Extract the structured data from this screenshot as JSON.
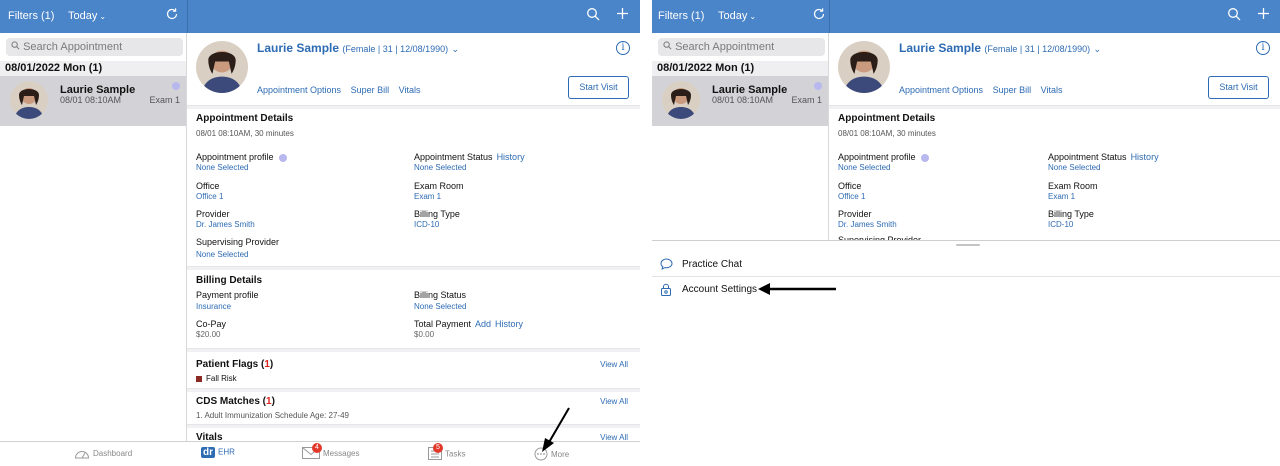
{
  "topbar": {
    "filters_label": "Filters (1)",
    "today_label": "Today",
    "chevron": "⌄",
    "refresh_icon": "refresh-icon",
    "search_icon": "search-icon",
    "add_icon": "plus-icon"
  },
  "list": {
    "search_placeholder": "Search Appointment",
    "date_header": "08/01/2022 Mon (1)",
    "appointment": {
      "name": "Laurie Sample",
      "time": "08/01 08:10AM",
      "room": "Exam 1"
    }
  },
  "patient": {
    "name": "Laurie Sample",
    "meta": "(Female | 31 | 12/08/1990)",
    "links": [
      "Appointment Options",
      "Super Bill",
      "Vitals"
    ],
    "start_visit": "Start Visit"
  },
  "appointment_details": {
    "title": "Appointment Details",
    "subtitle": "08/01 08:10AM, 30 minutes",
    "profile_label": "Appointment profile",
    "profile_value": "None Selected",
    "status_label": "Appointment Status",
    "status_history": "History",
    "status_value": "None Selected",
    "office_label": "Office",
    "office_value": "Office 1",
    "exam_room_label": "Exam Room",
    "exam_room_value": "Exam 1",
    "provider_label": "Provider",
    "provider_value": "Dr. James Smith",
    "billing_type_label": "Billing Type",
    "billing_type_value": "ICD-10",
    "supervising_label": "Supervising Provider",
    "supervising_value": "None Selected"
  },
  "billing_details": {
    "title": "Billing Details",
    "payment_profile_label": "Payment profile",
    "payment_profile_value": "Insurance",
    "billing_status_label": "Billing Status",
    "billing_status_value": "None Selected",
    "copay_label": "Co-Pay",
    "copay_value": "$20.00",
    "total_payment_label": "Total Payment",
    "total_add": "Add",
    "total_history": "History",
    "total_payment_value": "$0.00"
  },
  "patient_flags": {
    "title": "Patient Flags",
    "count": "1",
    "view_all": "View All",
    "flag": "Fall Risk"
  },
  "cds": {
    "title": "CDS Matches",
    "count": "1",
    "view_all": "View All",
    "item": "1. Adult Immunization Schedule Age: 27-49"
  },
  "vitals": {
    "title": "Vitals",
    "view_all": "View All"
  },
  "tabbar": {
    "dashboard": "Dashboard",
    "ehr_logo": "dr",
    "ehr": "EHR",
    "messages": "Messages",
    "messages_badge": "4",
    "tasks": "Tasks",
    "tasks_badge": "5",
    "more": "More"
  },
  "more_menu": {
    "items": [
      {
        "label": "Practice Chat",
        "icon": "chat-icon"
      },
      {
        "label": "Account Settings",
        "icon": "lock-settings-icon"
      }
    ]
  },
  "colors": {
    "accent": "#4a84c9",
    "link": "#2d6bb3",
    "badge": "#e2392b",
    "flag": "#8a2a22"
  }
}
